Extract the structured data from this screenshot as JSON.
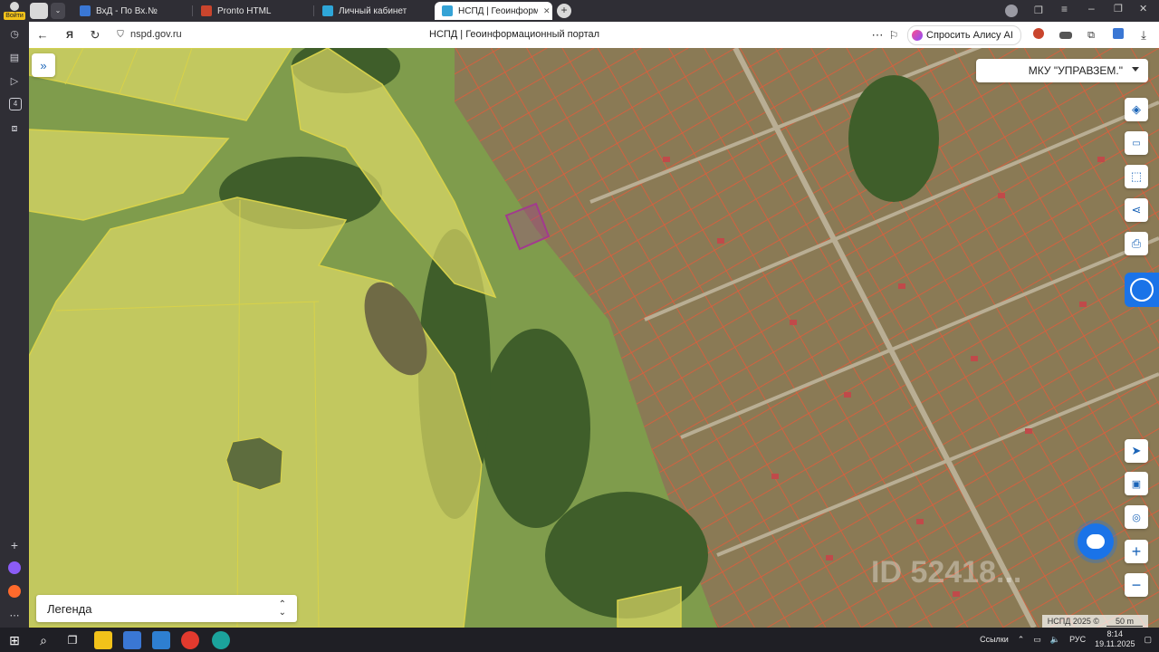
{
  "tabs": [
    {
      "label": "ВхД - По Вх.№",
      "color": "#3a77d4"
    },
    {
      "label": "Pronto HTML",
      "color": "#c9452d"
    },
    {
      "label": "Личный кабинет",
      "color": "#2ea6d8"
    },
    {
      "label": "НСПД | Геоинформац...",
      "color": "#35a3d6",
      "active": true
    }
  ],
  "browser": {
    "login_label": "Войти",
    "url": "nspd.gov.ru",
    "page_title": "НСПД | Геоинформационный портал",
    "ask_alisa": "Спросить Алису AI"
  },
  "map": {
    "org_select": "МКУ \"УПРАВЗЕМ.\"",
    "legend_label": "Легенда",
    "attribution": "НСПД 2025 ©",
    "scale_label": "50 m",
    "watermark": "ID 52418..."
  },
  "taskbar": {
    "links_label": "Ссылки",
    "lang": "РУС",
    "time": "8:14",
    "date": "19.11.2025"
  },
  "colors": {
    "accent": "#1a73e8",
    "cadastre_outline": "#e25b3a",
    "zone_fill": "#e6e06a",
    "selected_parcel": "#a23a8e"
  }
}
